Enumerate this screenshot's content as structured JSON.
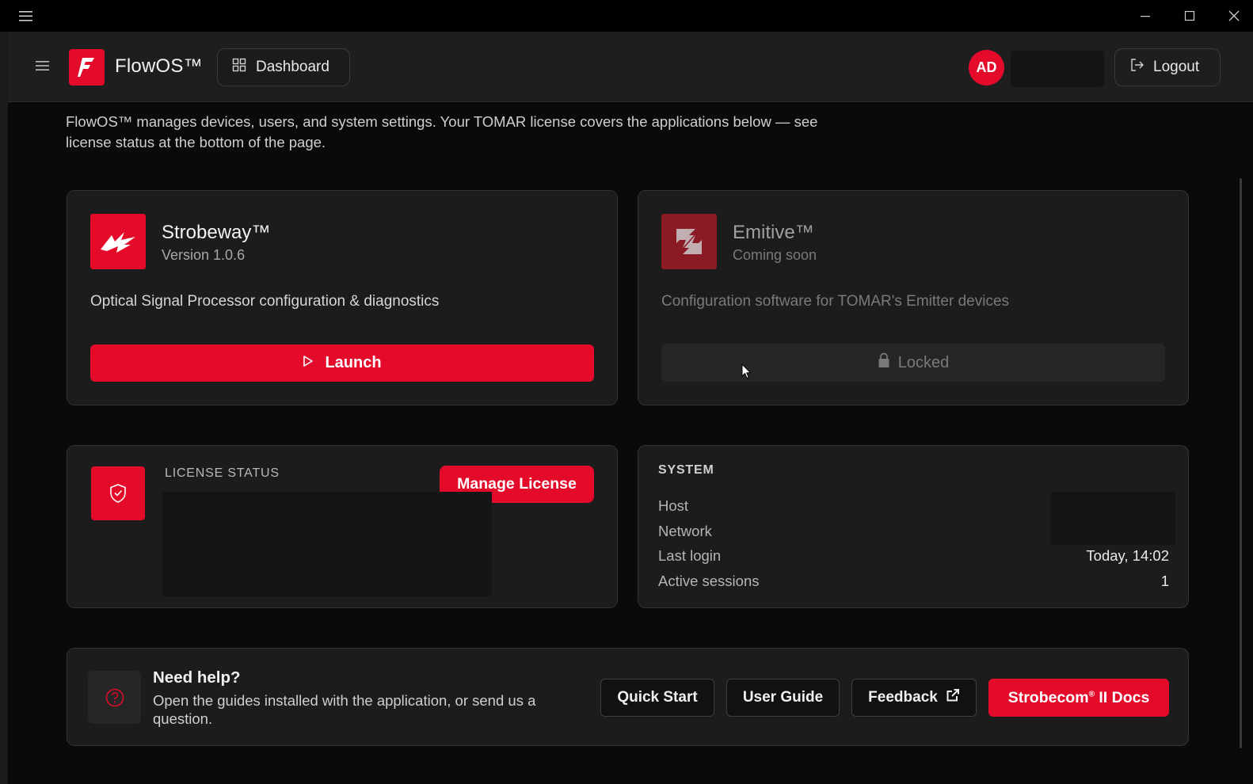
{
  "window": {
    "minimize_icon": "minimize-icon",
    "maximize_icon": "maximize-icon",
    "close_icon": "close-icon"
  },
  "header": {
    "brand": "FlowOS™",
    "dashboard_label": "Dashboard",
    "avatar_initials": "AD",
    "logout_label": "Logout"
  },
  "intro": {
    "text": "FlowOS™ manages devices, users, and system settings. Your TOMAR license covers the applications below — see license status at the bottom of the page."
  },
  "apps": [
    {
      "name": "Strobeway™",
      "subtitle": "Version 1.0.6",
      "description": "Optical Signal Processor configuration & diagnostics",
      "action_label": "Launch",
      "state": "available"
    },
    {
      "name": "Emitive™",
      "subtitle": "Coming soon",
      "description": "Configuration software for TOMAR's Emitter devices",
      "action_label": "Locked",
      "state": "locked"
    }
  ],
  "license": {
    "title": "LICENSE STATUS",
    "manage_label": "Manage License"
  },
  "system": {
    "title": "SYSTEM",
    "rows": [
      {
        "label": "Host",
        "value": ""
      },
      {
        "label": "Network",
        "value": ""
      },
      {
        "label": "Last login",
        "value": "Today, 14:02"
      },
      {
        "label": "Active sessions",
        "value": "1"
      }
    ]
  },
  "help": {
    "title": "Need help?",
    "description": "Open the guides installed with the application, or send us a question.",
    "buttons": {
      "quick_start": "Quick Start",
      "user_guide": "User Guide",
      "feedback": "Feedback",
      "docs_name": "Strobecom",
      "docs_mark": "®",
      "docs_suffix": " II Docs"
    }
  },
  "colors": {
    "accent": "#e30a2a",
    "background": "#0a0a0a",
    "card": "#1c1c1c"
  }
}
